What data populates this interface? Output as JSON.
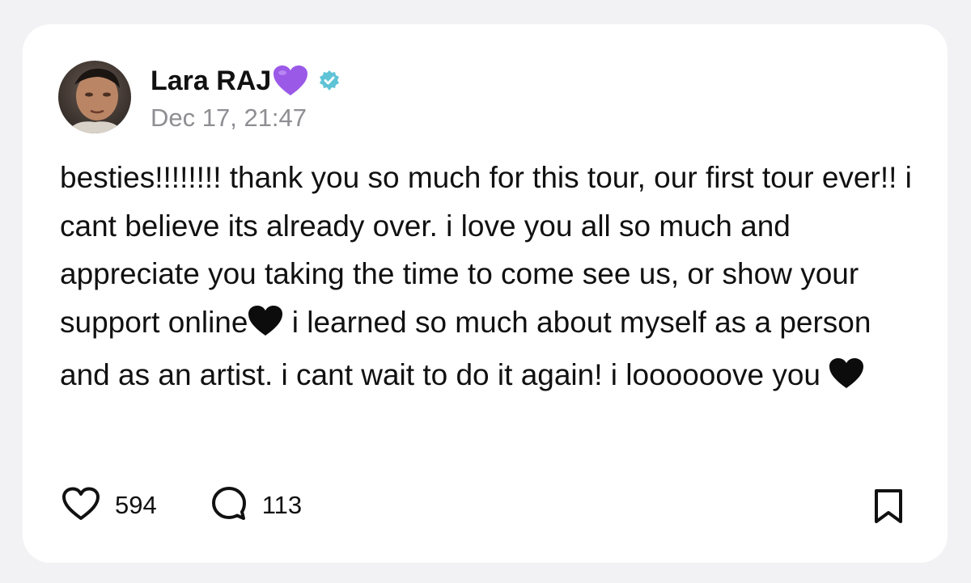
{
  "post": {
    "author_name": "Lara RAJ",
    "name_emoji": "purple-heart",
    "verified": true,
    "timestamp": "Dec 17, 21:47",
    "text_part_1": "besties!!!!!!!! thank you so much for this tour, our first tour ever!! i cant believe its already over. i love you all so much and appreciate you taking the time to come see us, or show your support online",
    "text_part_2": " i learned so much about myself as a person and as an artist. i cant wait to do it again! i loooooove you ",
    "inline_emoji": "black-heart"
  },
  "actions": {
    "likes": "594",
    "comments": "113"
  },
  "colors": {
    "background": "#f2f2f4",
    "card": "#ffffff",
    "text": "#111111",
    "muted": "#8e8e93",
    "verified_badge": "#5fc3d6",
    "purple_heart": "#9b59e8"
  },
  "icons": {
    "like": "heart-outline-icon",
    "comment": "speech-bubble-icon",
    "bookmark": "bookmark-icon"
  }
}
